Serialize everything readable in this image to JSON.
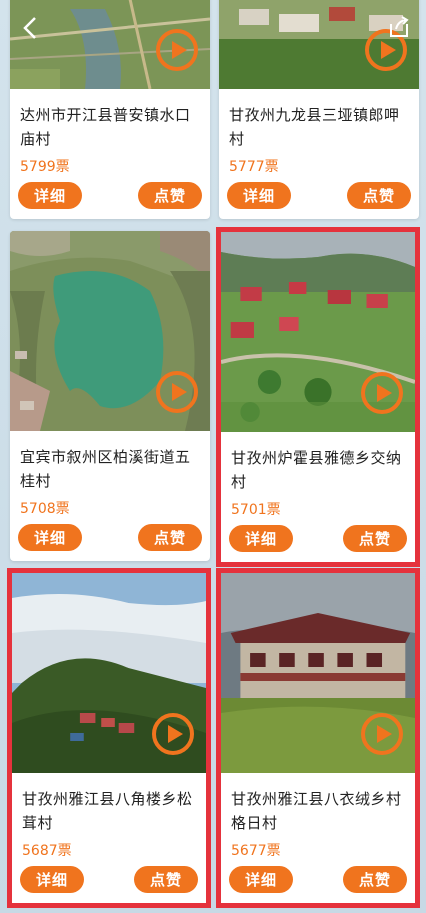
{
  "colors": {
    "accent": "#f0741e",
    "highlight": "#e5323c",
    "background": "#c9dbe6"
  },
  "topbar": {
    "back_icon": "chevron-left-icon",
    "share_icon": "share-icon"
  },
  "cards": [
    {
      "title": "达州市开江县普安镇水口庙村",
      "votes": "5799票",
      "detail_label": "详细",
      "like_label": "点赞",
      "highlighted": false
    },
    {
      "title": "甘孜州九龙县三垭镇郎呷村",
      "votes": "5777票",
      "detail_label": "详细",
      "like_label": "点赞",
      "highlighted": false
    },
    {
      "title": "宜宾市叙州区柏溪街道五桂村",
      "votes": "5708票",
      "detail_label": "详细",
      "like_label": "点赞",
      "highlighted": false
    },
    {
      "title": "甘孜州炉霍县雅德乡交纳村",
      "votes": "5701票",
      "detail_label": "详细",
      "like_label": "点赞",
      "highlighted": true
    },
    {
      "title": "甘孜州雅江县八角楼乡松茸村",
      "votes": "5687票",
      "detail_label": "详细",
      "like_label": "点赞",
      "highlighted": true
    },
    {
      "title": "甘孜州雅江县八衣绒乡村格日村",
      "votes": "5677票",
      "detail_label": "详细",
      "like_label": "点赞",
      "highlighted": true
    }
  ]
}
